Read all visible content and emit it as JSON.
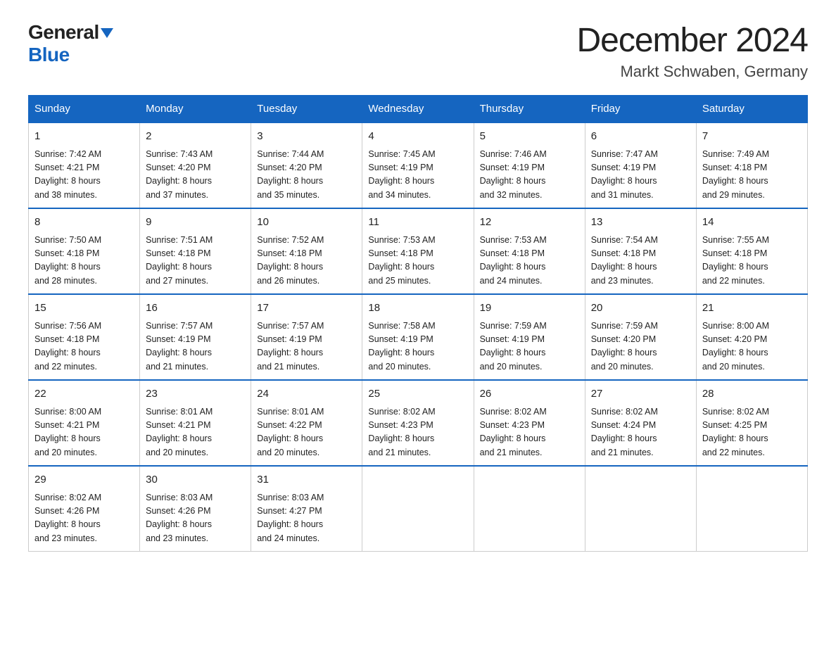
{
  "logo": {
    "general": "General",
    "blue": "Blue"
  },
  "title": "December 2024",
  "subtitle": "Markt Schwaben, Germany",
  "days_of_week": [
    "Sunday",
    "Monday",
    "Tuesday",
    "Wednesday",
    "Thursday",
    "Friday",
    "Saturday"
  ],
  "weeks": [
    [
      {
        "day": "1",
        "sunrise": "7:42 AM",
        "sunset": "4:21 PM",
        "daylight": "8 hours and 38 minutes."
      },
      {
        "day": "2",
        "sunrise": "7:43 AM",
        "sunset": "4:20 PM",
        "daylight": "8 hours and 37 minutes."
      },
      {
        "day": "3",
        "sunrise": "7:44 AM",
        "sunset": "4:20 PM",
        "daylight": "8 hours and 35 minutes."
      },
      {
        "day": "4",
        "sunrise": "7:45 AM",
        "sunset": "4:19 PM",
        "daylight": "8 hours and 34 minutes."
      },
      {
        "day": "5",
        "sunrise": "7:46 AM",
        "sunset": "4:19 PM",
        "daylight": "8 hours and 32 minutes."
      },
      {
        "day": "6",
        "sunrise": "7:47 AM",
        "sunset": "4:19 PM",
        "daylight": "8 hours and 31 minutes."
      },
      {
        "day": "7",
        "sunrise": "7:49 AM",
        "sunset": "4:18 PM",
        "daylight": "8 hours and 29 minutes."
      }
    ],
    [
      {
        "day": "8",
        "sunrise": "7:50 AM",
        "sunset": "4:18 PM",
        "daylight": "8 hours and 28 minutes."
      },
      {
        "day": "9",
        "sunrise": "7:51 AM",
        "sunset": "4:18 PM",
        "daylight": "8 hours and 27 minutes."
      },
      {
        "day": "10",
        "sunrise": "7:52 AM",
        "sunset": "4:18 PM",
        "daylight": "8 hours and 26 minutes."
      },
      {
        "day": "11",
        "sunrise": "7:53 AM",
        "sunset": "4:18 PM",
        "daylight": "8 hours and 25 minutes."
      },
      {
        "day": "12",
        "sunrise": "7:53 AM",
        "sunset": "4:18 PM",
        "daylight": "8 hours and 24 minutes."
      },
      {
        "day": "13",
        "sunrise": "7:54 AM",
        "sunset": "4:18 PM",
        "daylight": "8 hours and 23 minutes."
      },
      {
        "day": "14",
        "sunrise": "7:55 AM",
        "sunset": "4:18 PM",
        "daylight": "8 hours and 22 minutes."
      }
    ],
    [
      {
        "day": "15",
        "sunrise": "7:56 AM",
        "sunset": "4:18 PM",
        "daylight": "8 hours and 22 minutes."
      },
      {
        "day": "16",
        "sunrise": "7:57 AM",
        "sunset": "4:19 PM",
        "daylight": "8 hours and 21 minutes."
      },
      {
        "day": "17",
        "sunrise": "7:57 AM",
        "sunset": "4:19 PM",
        "daylight": "8 hours and 21 minutes."
      },
      {
        "day": "18",
        "sunrise": "7:58 AM",
        "sunset": "4:19 PM",
        "daylight": "8 hours and 20 minutes."
      },
      {
        "day": "19",
        "sunrise": "7:59 AM",
        "sunset": "4:19 PM",
        "daylight": "8 hours and 20 minutes."
      },
      {
        "day": "20",
        "sunrise": "7:59 AM",
        "sunset": "4:20 PM",
        "daylight": "8 hours and 20 minutes."
      },
      {
        "day": "21",
        "sunrise": "8:00 AM",
        "sunset": "4:20 PM",
        "daylight": "8 hours and 20 minutes."
      }
    ],
    [
      {
        "day": "22",
        "sunrise": "8:00 AM",
        "sunset": "4:21 PM",
        "daylight": "8 hours and 20 minutes."
      },
      {
        "day": "23",
        "sunrise": "8:01 AM",
        "sunset": "4:21 PM",
        "daylight": "8 hours and 20 minutes."
      },
      {
        "day": "24",
        "sunrise": "8:01 AM",
        "sunset": "4:22 PM",
        "daylight": "8 hours and 20 minutes."
      },
      {
        "day": "25",
        "sunrise": "8:02 AM",
        "sunset": "4:23 PM",
        "daylight": "8 hours and 21 minutes."
      },
      {
        "day": "26",
        "sunrise": "8:02 AM",
        "sunset": "4:23 PM",
        "daylight": "8 hours and 21 minutes."
      },
      {
        "day": "27",
        "sunrise": "8:02 AM",
        "sunset": "4:24 PM",
        "daylight": "8 hours and 21 minutes."
      },
      {
        "day": "28",
        "sunrise": "8:02 AM",
        "sunset": "4:25 PM",
        "daylight": "8 hours and 22 minutes."
      }
    ],
    [
      {
        "day": "29",
        "sunrise": "8:02 AM",
        "sunset": "4:26 PM",
        "daylight": "8 hours and 23 minutes."
      },
      {
        "day": "30",
        "sunrise": "8:03 AM",
        "sunset": "4:26 PM",
        "daylight": "8 hours and 23 minutes."
      },
      {
        "day": "31",
        "sunrise": "8:03 AM",
        "sunset": "4:27 PM",
        "daylight": "8 hours and 24 minutes."
      },
      null,
      null,
      null,
      null
    ]
  ],
  "labels": {
    "sunrise": "Sunrise:",
    "sunset": "Sunset:",
    "daylight": "Daylight:"
  }
}
